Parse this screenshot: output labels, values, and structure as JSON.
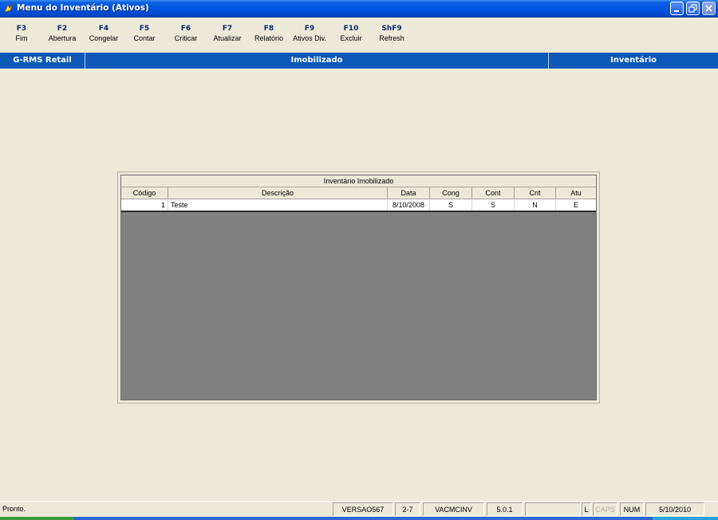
{
  "window": {
    "title": "Menu do Inventário (Ativos)"
  },
  "toolbar": {
    "items": [
      {
        "key": "F3",
        "label": "Fim"
      },
      {
        "key": "F2",
        "label": "Abertura"
      },
      {
        "key": "F4",
        "label": "Congelar"
      },
      {
        "key": "F5",
        "label": "Contar"
      },
      {
        "key": "F6",
        "label": "Criticar"
      },
      {
        "key": "F7",
        "label": "Atualizar"
      },
      {
        "key": "F8",
        "label": "Relatório"
      },
      {
        "key": "F9",
        "label": "Ativos Div."
      },
      {
        "key": "F10",
        "label": "Excluir"
      },
      {
        "key": "ShF9",
        "label": "Refresh"
      }
    ]
  },
  "header": {
    "left": "G-RMS Retail",
    "center": "Imobilizado",
    "right": "Inventário"
  },
  "grid": {
    "caption": "Inventário Imobilizado",
    "columns": [
      "Código",
      "Descrição",
      "Data",
      "Cong",
      "Cont",
      "Crit",
      "Atu"
    ],
    "rows": [
      {
        "codigo": "1",
        "descricao": "Teste",
        "data": "8/10/2008",
        "cong": "S",
        "cont": "S",
        "crit": "N",
        "atu": "E"
      }
    ]
  },
  "statusbar": {
    "message": "Pronto.",
    "version": "VERSAO567",
    "code": "2-7",
    "program": "VACMCINV",
    "release": "5.0.1",
    "indicator_l": "L",
    "indicator_caps": "CAPS",
    "indicator_num": "NUM",
    "date": "5/10/2010"
  },
  "colors": {
    "titlebar": "#0054e3",
    "header_band": "#0c59b8",
    "grid_background": "#808080",
    "window_background": "#ece9d8"
  }
}
